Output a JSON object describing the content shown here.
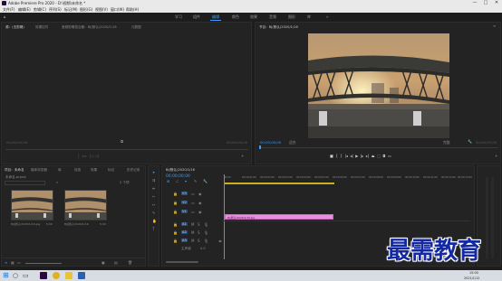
{
  "window": {
    "title": "Adobe Premiere Pro 2020 - D:\\视频\\未命名 *",
    "controls": {
      "minimize": "—",
      "maximize": "□",
      "close": "✕"
    }
  },
  "menu": [
    "文件(F)",
    "编辑(E)",
    "剪辑(C)",
    "序列(S)",
    "标记(M)",
    "图形(G)",
    "视图(V)",
    "窗口(W)",
    "帮助(H)"
  ],
  "workspaces": {
    "home_icon": "home-icon",
    "items": [
      "学习",
      "组件",
      "编辑",
      "颜色",
      "效果",
      "音频",
      "图形",
      "库"
    ],
    "active": "编辑",
    "more": "»"
  },
  "source_panel": {
    "tabs": [
      "源：(无剪辑)",
      "效果控件",
      "音频剪辑混合器：BJ(默认)2020/1/16",
      "元数据"
    ],
    "timecode_left": "00;00;00;00",
    "timecode_right": "00;00;00;00"
  },
  "program_panel": {
    "tab": "节目：BJ(默认)2020/1/16",
    "timecode": "00;00;00;00",
    "fit_label": "适合",
    "duration": "00;00;05;00",
    "full_label": "完整"
  },
  "project_panel": {
    "tabs": [
      "项目：未命名",
      "媒体浏览器",
      "库",
      "信息",
      "效果",
      "标记",
      "历史记录"
    ],
    "project_name": "未命名.prproj",
    "items_count": "2 个项",
    "clips": [
      {
        "name": "BJ(默认)2020/1/16.jpg",
        "duration": "5:00"
      },
      {
        "name": "BJ(默认)2020/1/16",
        "duration": "5:00"
      }
    ]
  },
  "timeline": {
    "tab": "BJ(默认)2020/1/16",
    "timecode": "00;00;00;00",
    "ruler": [
      "00;00",
      "00;00;01;00",
      "00;00;02;00",
      "00;00;03;00",
      "00;00;04;00",
      "00;00;05;00",
      "00;00;06;00",
      "00;00;07;00",
      "00;00;08;00",
      "00;00;09;00",
      "00;00;10;00",
      "00;00;11;00",
      "00;00;12;00",
      "00;00;13;00"
    ],
    "video_tracks": [
      "V3",
      "V2",
      "V1"
    ],
    "audio_tracks": [
      "A1",
      "A2",
      "A3"
    ],
    "master_label": "主声道",
    "master_value": "0.0",
    "clip_label": "BJ(默认)2020/1/16.jpg"
  },
  "taskbar": {
    "time": "15:00",
    "date": "2021/1/12"
  },
  "watermark": "最需教育",
  "colors": {
    "accent": "#3a9cff",
    "clip": "#e98fe0",
    "watermark": "#1428a0"
  }
}
